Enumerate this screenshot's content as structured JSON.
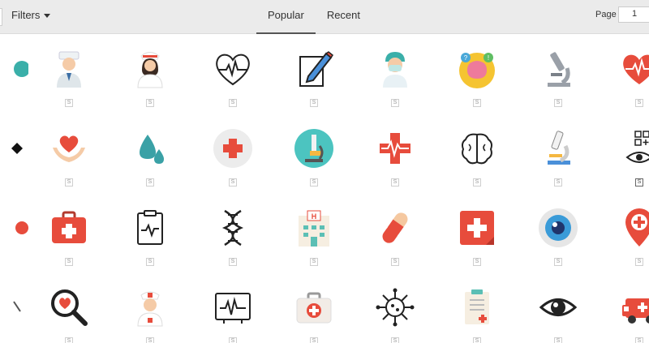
{
  "toolbar": {
    "filters_label": "Filters",
    "page_label": "Page",
    "page_value": "1"
  },
  "tabs": [
    {
      "label": "Popular",
      "active": true
    },
    {
      "label": "Recent",
      "active": false
    }
  ],
  "premium_badge": "S",
  "rows": [
    [
      "doctor-icon",
      "nurse-icon",
      "heartbeat-icon",
      "prescription-pen-icon",
      "surgeon-icon",
      "brain-icon",
      "microscope-icon",
      "heart-monitor-icon"
    ],
    [
      "care-heart-icon",
      "blood-drops-icon",
      "medical-cross-icon",
      "microscope-circle-icon",
      "health-cross-icon",
      "brain-outline-icon",
      "lab-microscope-icon",
      "eye-grid-icon"
    ],
    [
      "first-aid-kit-icon",
      "clipboard-pulse-icon",
      "dna-icon",
      "hospital-icon",
      "pill-capsule-icon",
      "medical-note-icon",
      "eyeball-icon",
      "location-pin-icon"
    ],
    [
      "health-search-icon",
      "nurse-cap-icon",
      "ecg-monitor-icon",
      "medical-bag-icon",
      "virus-icon",
      "medical-checklist-icon",
      "eye-outline-icon",
      "ambulance-icon"
    ]
  ],
  "colors": {
    "red": "#e74c3c",
    "skin": "#f4c8a6",
    "teal": "#3aafa9",
    "blue": "#3498db"
  }
}
